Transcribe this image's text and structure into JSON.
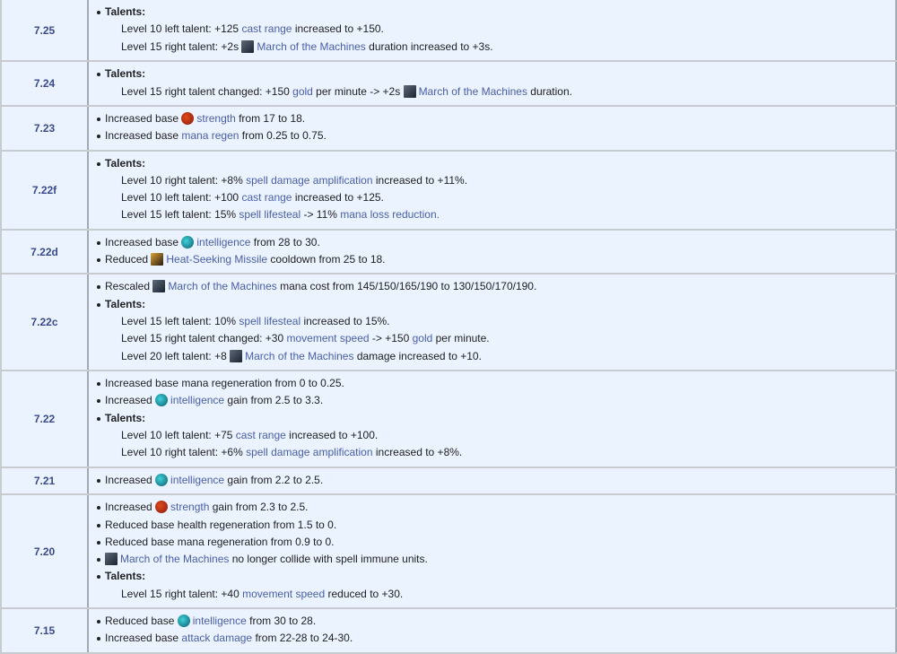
{
  "rows": [
    {
      "version": "7.25",
      "items": [
        {
          "type": "header",
          "text": "Talents:"
        },
        {
          "type": "sub",
          "parts": [
            {
              "t": "Level 10 left talent: +125 "
            },
            {
              "l": "cast range"
            },
            {
              "t": " increased to +150."
            }
          ]
        },
        {
          "type": "sub",
          "parts": [
            {
              "t": "Level 15 right talent: +2s "
            },
            {
              "i": "march-of-the-machines-icon"
            },
            {
              "l": "March of the Machines"
            },
            {
              "t": " duration increased to +3s."
            }
          ]
        }
      ]
    },
    {
      "version": "7.24",
      "items": [
        {
          "type": "header",
          "text": "Talents:"
        },
        {
          "type": "sub",
          "parts": [
            {
              "t": "Level 15 right talent changed: +150 "
            },
            {
              "l": "gold"
            },
            {
              "t": " per minute -> +2s "
            },
            {
              "i": "march-of-the-machines-icon"
            },
            {
              "l": "March of the Machines"
            },
            {
              "t": " duration."
            }
          ]
        }
      ]
    },
    {
      "version": "7.23",
      "items": [
        {
          "type": "bullet",
          "parts": [
            {
              "t": "Increased base "
            },
            {
              "i": "strength-icon"
            },
            {
              "l": "strength"
            },
            {
              "t": " from 17 to 18."
            }
          ]
        },
        {
          "type": "bullet",
          "parts": [
            {
              "t": "Increased base "
            },
            {
              "l": "mana regen"
            },
            {
              "t": " from 0.25 to 0.75."
            }
          ]
        }
      ]
    },
    {
      "version": "7.22f",
      "items": [
        {
          "type": "header",
          "text": "Talents:"
        },
        {
          "type": "sub",
          "parts": [
            {
              "t": "Level 10 right talent: +8% "
            },
            {
              "l": "spell damage amplification"
            },
            {
              "t": " increased to +11%."
            }
          ]
        },
        {
          "type": "sub",
          "parts": [
            {
              "t": "Level 10 left talent: +100 "
            },
            {
              "l": "cast range"
            },
            {
              "t": " increased to +125."
            }
          ]
        },
        {
          "type": "sub",
          "parts": [
            {
              "t": "Level 15 left talent: 15% "
            },
            {
              "l": "spell lifesteal"
            },
            {
              "t": " -> 11% "
            },
            {
              "l": "mana loss reduction."
            }
          ]
        }
      ]
    },
    {
      "version": "7.22d",
      "items": [
        {
          "type": "bullet",
          "parts": [
            {
              "t": "Increased base "
            },
            {
              "i": "intelligence-icon"
            },
            {
              "l": "intelligence"
            },
            {
              "t": " from 28 to 30."
            }
          ]
        },
        {
          "type": "bullet",
          "parts": [
            {
              "t": "Reduced "
            },
            {
              "i": "heat-seeking-missile-icon"
            },
            {
              "l": "Heat-Seeking Missile"
            },
            {
              "t": " cooldown from 25 to 18."
            }
          ]
        }
      ]
    },
    {
      "version": "7.22c",
      "items": [
        {
          "type": "bullet",
          "parts": [
            {
              "t": "Rescaled "
            },
            {
              "i": "march-of-the-machines-icon"
            },
            {
              "l": "March of the Machines"
            },
            {
              "t": " mana cost from 145/150/165/190 to 130/150/170/190."
            }
          ]
        },
        {
          "type": "header",
          "text": "Talents:"
        },
        {
          "type": "sub",
          "parts": [
            {
              "t": "Level 15 left talent: 10% "
            },
            {
              "l": "spell lifesteal"
            },
            {
              "t": " increased to 15%."
            }
          ]
        },
        {
          "type": "sub",
          "parts": [
            {
              "t": "Level 15 right talent changed: +30 "
            },
            {
              "l": "movement speed"
            },
            {
              "t": " -> +150 "
            },
            {
              "l": "gold"
            },
            {
              "t": " per minute."
            }
          ]
        },
        {
          "type": "sub",
          "parts": [
            {
              "t": "Level 20 left talent: +8 "
            },
            {
              "i": "march-of-the-machines-icon"
            },
            {
              "l": "March of the Machines"
            },
            {
              "t": " damage increased to +10."
            }
          ]
        }
      ]
    },
    {
      "version": "7.22",
      "items": [
        {
          "type": "bullet",
          "parts": [
            {
              "t": "Increased base mana regeneration from 0 to 0.25."
            }
          ]
        },
        {
          "type": "bullet",
          "parts": [
            {
              "t": "Increased "
            },
            {
              "i": "intelligence-icon"
            },
            {
              "l": "intelligence"
            },
            {
              "t": " gain from 2.5 to 3.3."
            }
          ]
        },
        {
          "type": "header",
          "text": "Talents:"
        },
        {
          "type": "sub",
          "parts": [
            {
              "t": "Level 10 left talent: +75 "
            },
            {
              "l": "cast range"
            },
            {
              "t": " increased to +100."
            }
          ]
        },
        {
          "type": "sub",
          "parts": [
            {
              "t": "Level 10 right talent: +6% "
            },
            {
              "l": "spell damage amplification"
            },
            {
              "t": " increased to +8%."
            }
          ]
        }
      ]
    },
    {
      "version": "7.21",
      "items": [
        {
          "type": "bullet",
          "parts": [
            {
              "t": "Increased "
            },
            {
              "i": "intelligence-icon"
            },
            {
              "l": "intelligence"
            },
            {
              "t": " gain from 2.2 to 2.5."
            }
          ]
        }
      ]
    },
    {
      "version": "7.20",
      "items": [
        {
          "type": "bullet",
          "parts": [
            {
              "t": "Increased "
            },
            {
              "i": "strength-icon"
            },
            {
              "l": "strength"
            },
            {
              "t": " gain from 2.3 to 2.5."
            }
          ]
        },
        {
          "type": "bullet",
          "parts": [
            {
              "t": "Reduced base health regeneration from 1.5 to 0."
            }
          ]
        },
        {
          "type": "bullet",
          "parts": [
            {
              "t": "Reduced base mana regeneration from 0.9 to 0."
            }
          ]
        },
        {
          "type": "bullet",
          "parts": [
            {
              "i": "march-of-the-machines-icon"
            },
            {
              "l": "March of the Machines"
            },
            {
              "t": " no longer collide with spell immune units."
            }
          ]
        },
        {
          "type": "header",
          "text": "Talents:"
        },
        {
          "type": "sub",
          "parts": [
            {
              "t": "Level 15 right talent: +40 "
            },
            {
              "l": "movement speed"
            },
            {
              "t": " reduced to +30."
            }
          ]
        }
      ]
    },
    {
      "version": "7.15",
      "items": [
        {
          "type": "bullet",
          "parts": [
            {
              "t": "Reduced base "
            },
            {
              "i": "intelligence-icon"
            },
            {
              "l": "intelligence"
            },
            {
              "t": " from 30 to 28."
            }
          ]
        },
        {
          "type": "bullet",
          "parts": [
            {
              "t": "Increased base "
            },
            {
              "l": "attack damage"
            },
            {
              "t": " from 22-28 to 24-30."
            }
          ]
        }
      ]
    }
  ]
}
